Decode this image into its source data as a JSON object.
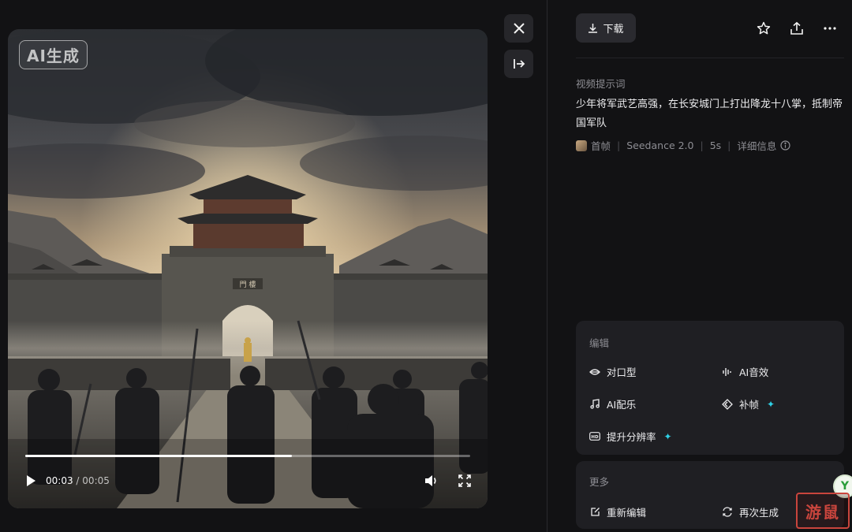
{
  "video": {
    "badge": "AI生成",
    "progress": 0.6,
    "current_time": "00:03",
    "time_separator": "/",
    "duration": "00:05",
    "icons": {
      "play": "play-icon",
      "volume": "volume-icon",
      "fullscreen": "fullscreen-icon"
    },
    "scene": {
      "gate_plaque": "門 樓"
    }
  },
  "side_buttons": {
    "close": "close-icon",
    "collapse": "collapse-panel-icon"
  },
  "header": {
    "download_label": "下载",
    "icons": [
      "star-icon",
      "share-icon",
      "more-icon"
    ]
  },
  "prompt": {
    "label": "视频提示词",
    "text": "少年将军武艺高强，在长安城门上打出降龙十八掌，抵制帝国军队",
    "meta": {
      "frame_label": "首帧",
      "model": "Seedance 2.0",
      "length": "5s",
      "details": "详细信息"
    }
  },
  "edit_card": {
    "title": "编辑",
    "tools": [
      {
        "label": "对口型",
        "icon": "lips-icon"
      },
      {
        "label": "AI音效",
        "icon": "audio-wave-icon"
      },
      {
        "label": "AI配乐",
        "icon": "music-note-icon"
      },
      {
        "label": "补帧",
        "icon": "frame-interpolate-icon",
        "badge": "✦"
      },
      {
        "label": "提升分辨率",
        "icon": "hd-icon",
        "badge": "✦"
      }
    ]
  },
  "more_card": {
    "title": "更多",
    "tools": [
      {
        "label": "重新编辑",
        "icon": "re-edit-icon"
      },
      {
        "label": "再次生成",
        "icon": "regenerate-icon"
      }
    ]
  },
  "overlay": {
    "float_letter": "Y",
    "watermark": "游鼠"
  },
  "colors": {
    "background": "#121214",
    "card": "#1f1f23",
    "accent_spark": "#2fd1e6",
    "muted_text": "#8d8d93"
  }
}
